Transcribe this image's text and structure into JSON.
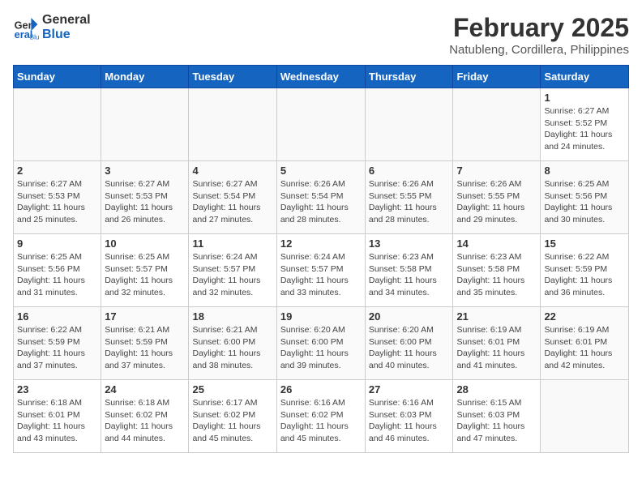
{
  "header": {
    "logo_line1": "General",
    "logo_line2": "Blue",
    "month_title": "February 2025",
    "location": "Natubleng, Cordillera, Philippines"
  },
  "weekdays": [
    "Sunday",
    "Monday",
    "Tuesday",
    "Wednesday",
    "Thursday",
    "Friday",
    "Saturday"
  ],
  "weeks": [
    [
      {
        "day": "",
        "info": ""
      },
      {
        "day": "",
        "info": ""
      },
      {
        "day": "",
        "info": ""
      },
      {
        "day": "",
        "info": ""
      },
      {
        "day": "",
        "info": ""
      },
      {
        "day": "",
        "info": ""
      },
      {
        "day": "1",
        "info": "Sunrise: 6:27 AM\nSunset: 5:52 PM\nDaylight: 11 hours and 24 minutes."
      }
    ],
    [
      {
        "day": "2",
        "info": "Sunrise: 6:27 AM\nSunset: 5:53 PM\nDaylight: 11 hours and 25 minutes."
      },
      {
        "day": "3",
        "info": "Sunrise: 6:27 AM\nSunset: 5:53 PM\nDaylight: 11 hours and 26 minutes."
      },
      {
        "day": "4",
        "info": "Sunrise: 6:27 AM\nSunset: 5:54 PM\nDaylight: 11 hours and 27 minutes."
      },
      {
        "day": "5",
        "info": "Sunrise: 6:26 AM\nSunset: 5:54 PM\nDaylight: 11 hours and 28 minutes."
      },
      {
        "day": "6",
        "info": "Sunrise: 6:26 AM\nSunset: 5:55 PM\nDaylight: 11 hours and 28 minutes."
      },
      {
        "day": "7",
        "info": "Sunrise: 6:26 AM\nSunset: 5:55 PM\nDaylight: 11 hours and 29 minutes."
      },
      {
        "day": "8",
        "info": "Sunrise: 6:25 AM\nSunset: 5:56 PM\nDaylight: 11 hours and 30 minutes."
      }
    ],
    [
      {
        "day": "9",
        "info": "Sunrise: 6:25 AM\nSunset: 5:56 PM\nDaylight: 11 hours and 31 minutes."
      },
      {
        "day": "10",
        "info": "Sunrise: 6:25 AM\nSunset: 5:57 PM\nDaylight: 11 hours and 32 minutes."
      },
      {
        "day": "11",
        "info": "Sunrise: 6:24 AM\nSunset: 5:57 PM\nDaylight: 11 hours and 32 minutes."
      },
      {
        "day": "12",
        "info": "Sunrise: 6:24 AM\nSunset: 5:57 PM\nDaylight: 11 hours and 33 minutes."
      },
      {
        "day": "13",
        "info": "Sunrise: 6:23 AM\nSunset: 5:58 PM\nDaylight: 11 hours and 34 minutes."
      },
      {
        "day": "14",
        "info": "Sunrise: 6:23 AM\nSunset: 5:58 PM\nDaylight: 11 hours and 35 minutes."
      },
      {
        "day": "15",
        "info": "Sunrise: 6:22 AM\nSunset: 5:59 PM\nDaylight: 11 hours and 36 minutes."
      }
    ],
    [
      {
        "day": "16",
        "info": "Sunrise: 6:22 AM\nSunset: 5:59 PM\nDaylight: 11 hours and 37 minutes."
      },
      {
        "day": "17",
        "info": "Sunrise: 6:21 AM\nSunset: 5:59 PM\nDaylight: 11 hours and 37 minutes."
      },
      {
        "day": "18",
        "info": "Sunrise: 6:21 AM\nSunset: 6:00 PM\nDaylight: 11 hours and 38 minutes."
      },
      {
        "day": "19",
        "info": "Sunrise: 6:20 AM\nSunset: 6:00 PM\nDaylight: 11 hours and 39 minutes."
      },
      {
        "day": "20",
        "info": "Sunrise: 6:20 AM\nSunset: 6:00 PM\nDaylight: 11 hours and 40 minutes."
      },
      {
        "day": "21",
        "info": "Sunrise: 6:19 AM\nSunset: 6:01 PM\nDaylight: 11 hours and 41 minutes."
      },
      {
        "day": "22",
        "info": "Sunrise: 6:19 AM\nSunset: 6:01 PM\nDaylight: 11 hours and 42 minutes."
      }
    ],
    [
      {
        "day": "23",
        "info": "Sunrise: 6:18 AM\nSunset: 6:01 PM\nDaylight: 11 hours and 43 minutes."
      },
      {
        "day": "24",
        "info": "Sunrise: 6:18 AM\nSunset: 6:02 PM\nDaylight: 11 hours and 44 minutes."
      },
      {
        "day": "25",
        "info": "Sunrise: 6:17 AM\nSunset: 6:02 PM\nDaylight: 11 hours and 45 minutes."
      },
      {
        "day": "26",
        "info": "Sunrise: 6:16 AM\nSunset: 6:02 PM\nDaylight: 11 hours and 45 minutes."
      },
      {
        "day": "27",
        "info": "Sunrise: 6:16 AM\nSunset: 6:03 PM\nDaylight: 11 hours and 46 minutes."
      },
      {
        "day": "28",
        "info": "Sunrise: 6:15 AM\nSunset: 6:03 PM\nDaylight: 11 hours and 47 minutes."
      },
      {
        "day": "",
        "info": ""
      }
    ]
  ]
}
